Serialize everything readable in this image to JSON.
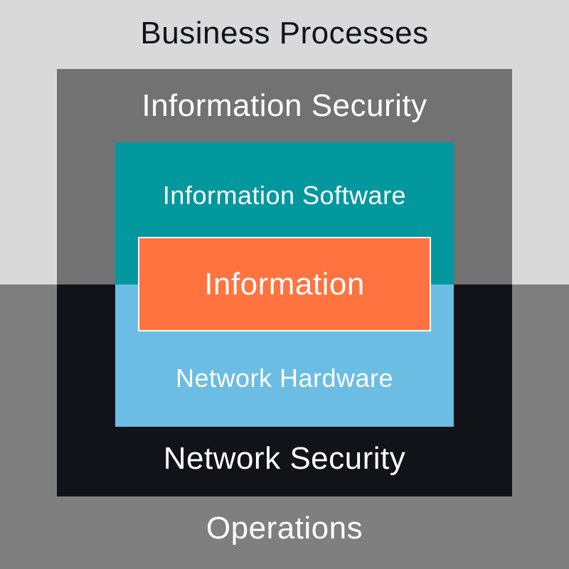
{
  "colors": {
    "business_processes_bg": "#d9d9d9",
    "operations_bg": "#7f7f7f",
    "information_security_bg": "#727272",
    "network_security_bg": "#111318",
    "information_software_bg": "#03989e",
    "network_hardware_bg": "#6bbde3",
    "information_bg": "#ff7340",
    "dark_text": "#111318",
    "light_text": "#ffffff"
  },
  "layers": {
    "business_processes": "Business Processes",
    "information_security": "Information Security",
    "information_software": "Information Software",
    "information": "Information",
    "network_hardware": "Network Hardware",
    "network_security": "Network Security",
    "operations": "Operations"
  }
}
